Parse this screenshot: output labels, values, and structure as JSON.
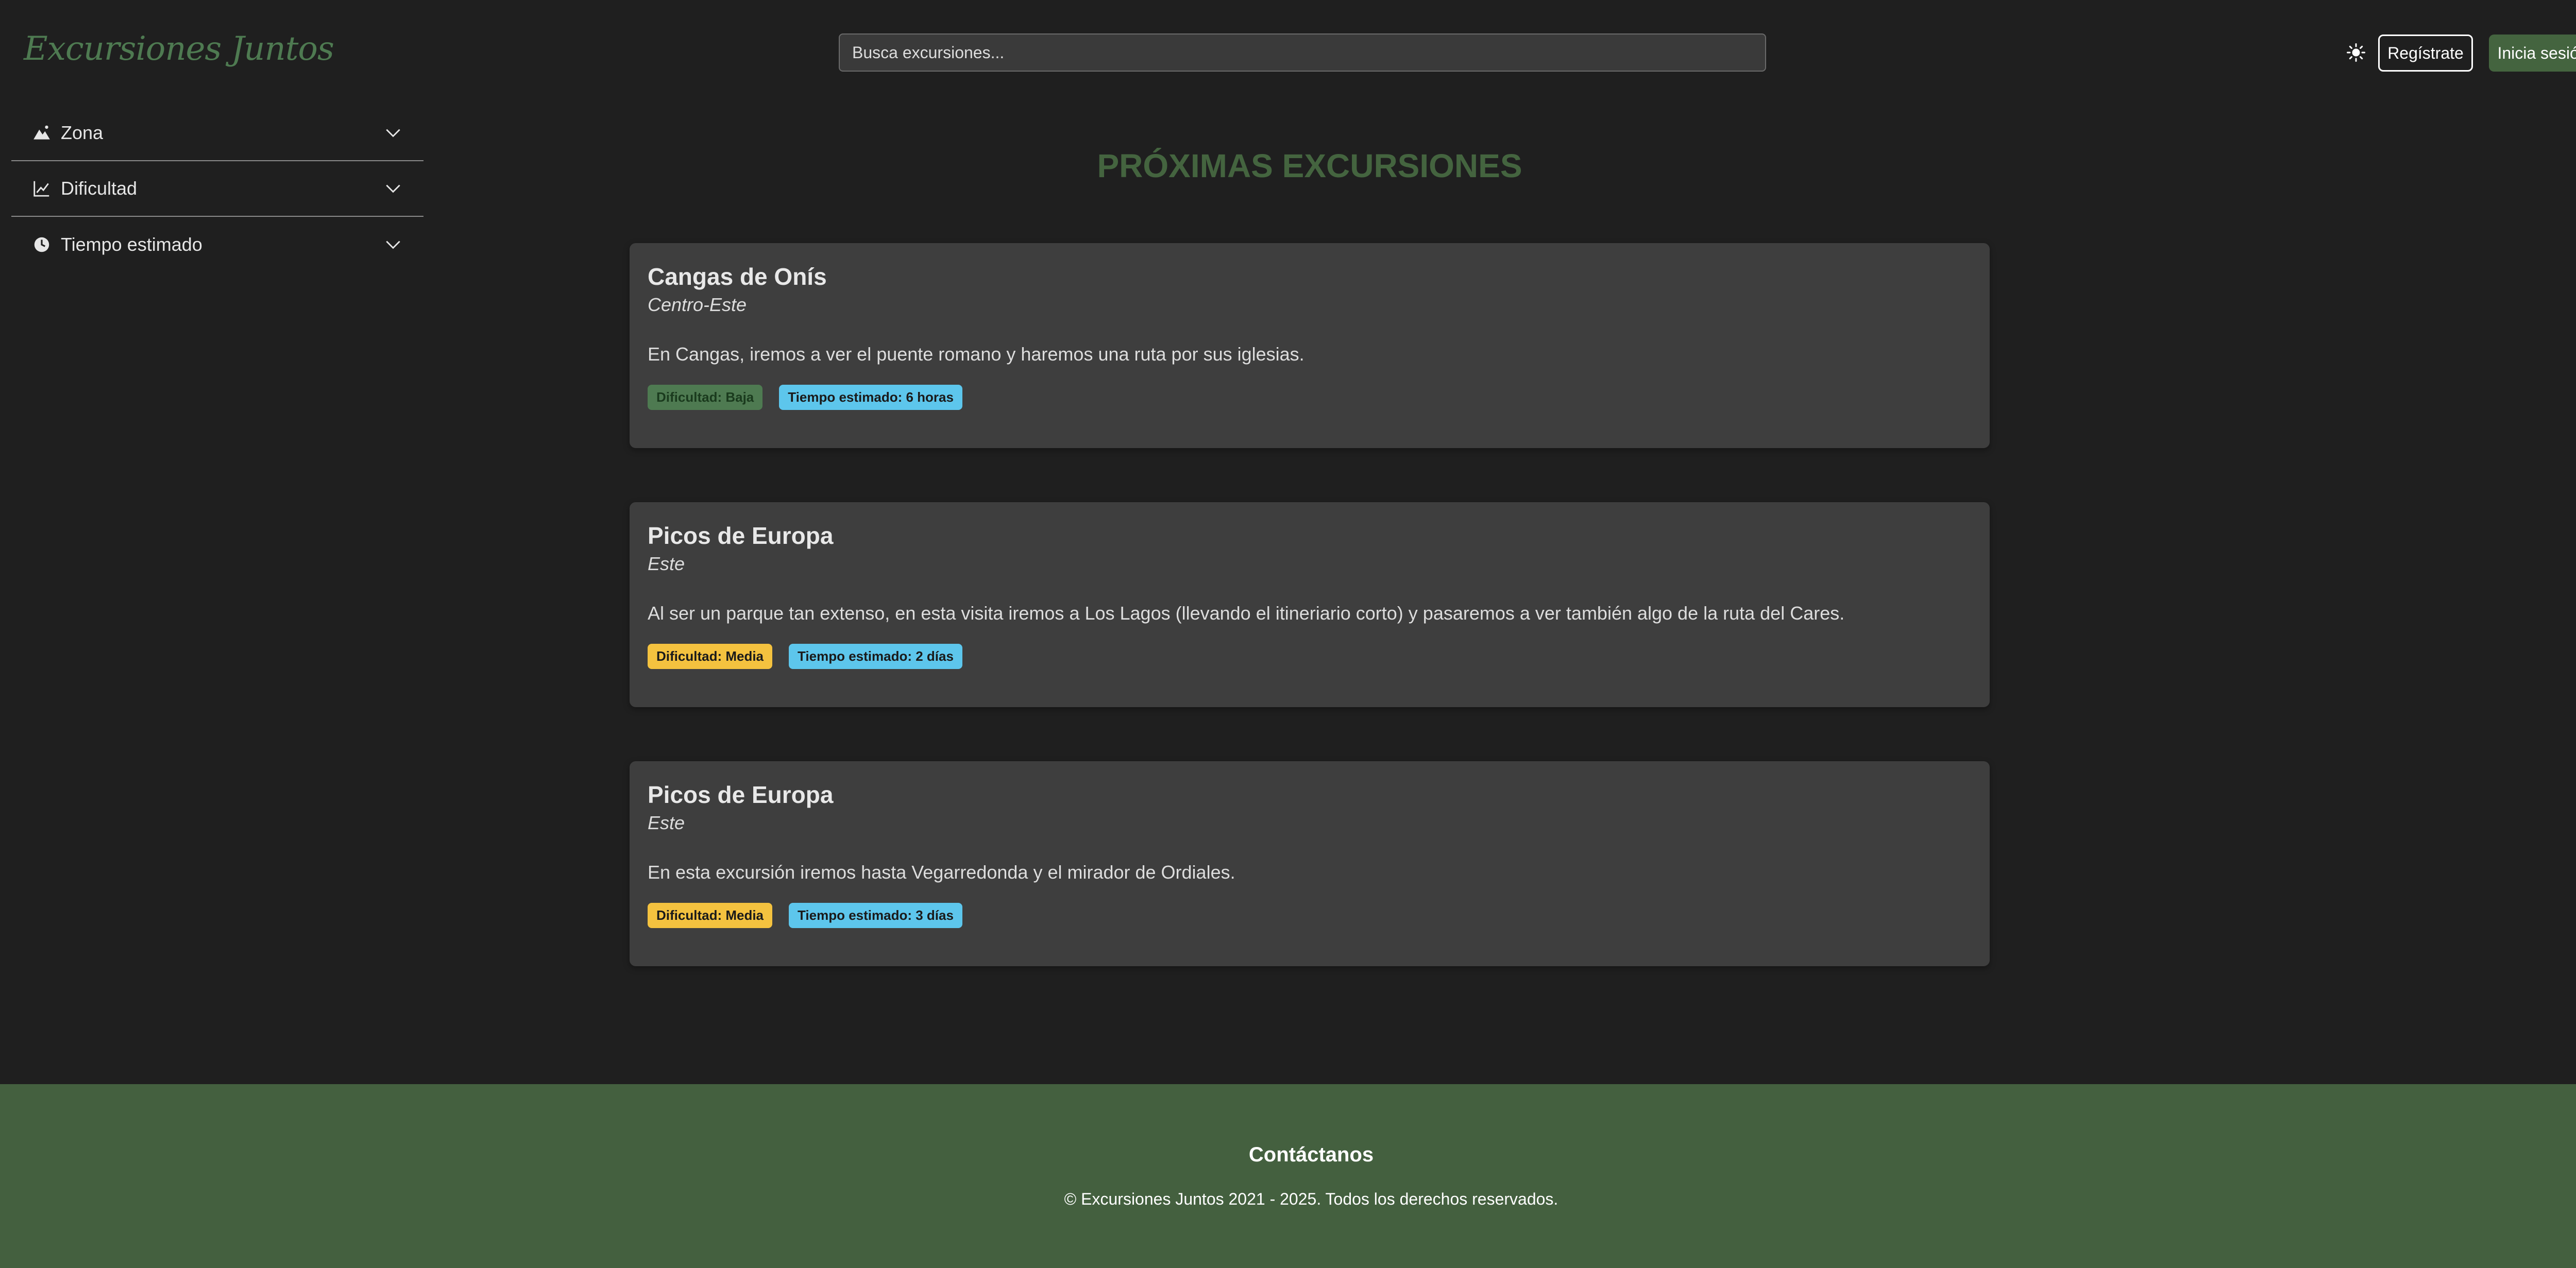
{
  "header": {
    "logo_text": "Excursiones Juntos",
    "search_placeholder": "Busca excursiones...",
    "theme_icon": "sun-icon",
    "register_label": "Regístrate",
    "login_label": "Inicia sesión"
  },
  "sidebar": {
    "filters": [
      {
        "label": "Zona",
        "icon": "mountain-icon"
      },
      {
        "label": "Dificultad",
        "icon": "chart-line-icon"
      },
      {
        "label": "Tiempo estimado",
        "icon": "clock-icon"
      }
    ]
  },
  "main": {
    "title": "PRÓXIMAS EXCURSIONES",
    "cards": [
      {
        "title": "Cangas de Onís",
        "zone": "Centro-Este",
        "description": "En Cangas, iremos a ver el puente romano y haremos una ruta por sus iglesias.",
        "difficulty": "Dificultad: Baja",
        "time": "Tiempo estimado: 6 horas"
      },
      {
        "title": "Picos de Europa",
        "zone": "Este",
        "description": "Al ser un parque tan extenso, en esta visita iremos a Los Lagos (llevando el itineriario corto) y pasaremos a ver también algo de la ruta del Cares.",
        "difficulty": "Dificultad: Media",
        "time": "Tiempo estimado: 2 días"
      },
      {
        "title": "Picos de Europa",
        "zone": "Este",
        "description": "En esta excursión iremos hasta Vegarredonda y el mirador de Ordiales.",
        "difficulty": "Dificultad: Media",
        "time": "Tiempo estimado: 3 días"
      }
    ]
  },
  "footer": {
    "contact": "Contáctanos",
    "copyright": "© Excursiones Juntos 2021 - 2025. Todos los derechos reservados."
  },
  "colors": {
    "background": "#1f1f1f",
    "card": "#3e3e3e",
    "accent_green": "#44643f",
    "difficulty_low": "#4e7a51",
    "difficulty_medium": "#f4c23f",
    "time_badge": "#5dc6ec"
  }
}
